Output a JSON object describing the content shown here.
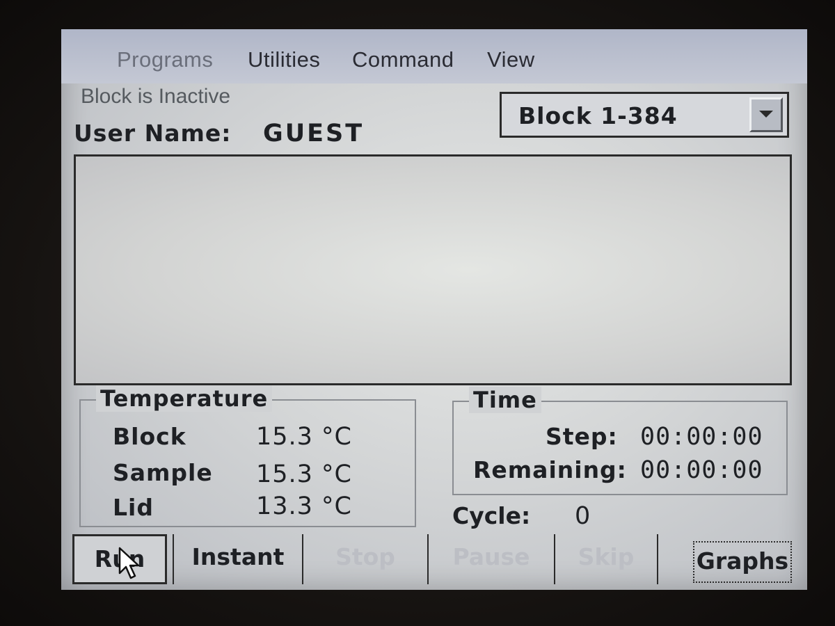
{
  "menu": {
    "items": [
      "Programs",
      "Utilities",
      "Command",
      "View"
    ]
  },
  "status": {
    "text": "Block is Inactive"
  },
  "user": {
    "label": "User Name:",
    "value": "GUEST"
  },
  "block_select": {
    "value": "Block 1-384"
  },
  "temperature": {
    "title": "Temperature",
    "rows": [
      {
        "label": "Block",
        "value": "15.3 °C"
      },
      {
        "label": "Sample",
        "value": "15.3 °C"
      },
      {
        "label": "Lid",
        "value": "13.3 °C"
      }
    ]
  },
  "time": {
    "title": "Time",
    "step_label": "Step:",
    "step_value": "00:00:00",
    "remaining_label": "Remaining:",
    "remaining_value": "00:00:00"
  },
  "cycle": {
    "label": "Cycle:",
    "value": "0"
  },
  "buttons": {
    "run": "Run",
    "instant": "Instant",
    "stop": "Stop",
    "pause": "Pause",
    "skip": "Skip",
    "graphs": "Graphs"
  }
}
